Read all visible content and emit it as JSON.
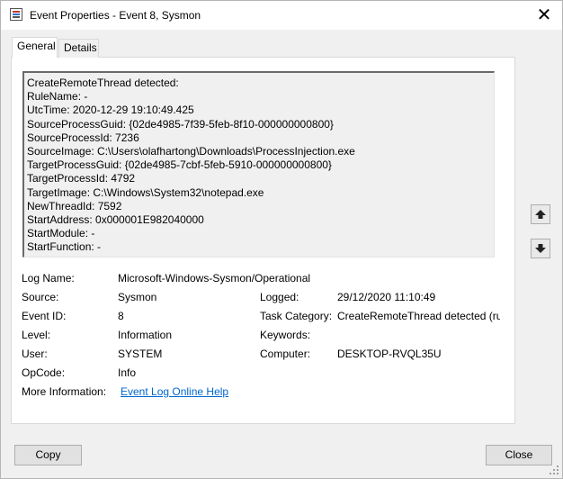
{
  "window": {
    "title": "Event Properties - Event 8, Sysmon",
    "icon": "event-viewer-icon",
    "close_glyph": "✕"
  },
  "tabs": [
    {
      "label": "General",
      "active": true
    },
    {
      "label": "Details",
      "active": false
    }
  ],
  "description": [
    "CreateRemoteThread detected:",
    "RuleName: -",
    "UtcTime: 2020-12-29 19:10:49.425",
    "SourceProcessGuid: {02de4985-7f39-5feb-8f10-000000000800}",
    "SourceProcessId: 7236",
    "SourceImage: C:\\Users\\olafhartong\\Downloads\\ProcessInjection.exe",
    "TargetProcessGuid: {02de4985-7cbf-5feb-5910-000000000800}",
    "TargetProcessId: 4792",
    "TargetImage: C:\\Windows\\System32\\notepad.exe",
    "NewThreadId: 7592",
    "StartAddress: 0x000001E982040000",
    "StartModule: -",
    "StartFunction: -"
  ],
  "fields": {
    "log_name": {
      "label": "Log Name:",
      "value": "Microsoft-Windows-Sysmon/Operational"
    },
    "source": {
      "label": "Source:",
      "value": "Sysmon"
    },
    "logged": {
      "label": "Logged:",
      "value": "29/12/2020 11:10:49"
    },
    "event_id": {
      "label": "Event ID:",
      "value": "8"
    },
    "task_category": {
      "label": "Task Category:",
      "value": "CreateRemoteThread detected (rul"
    },
    "level": {
      "label": "Level:",
      "value": "Information"
    },
    "keywords": {
      "label": "Keywords:",
      "value": ""
    },
    "user": {
      "label": "User:",
      "value": "SYSTEM"
    },
    "computer": {
      "label": "Computer:",
      "value": "DESKTOP-RVQL35U"
    },
    "opcode": {
      "label": "OpCode:",
      "value": "Info"
    },
    "more_info": {
      "label": "More Information:",
      "value": "Event Log Online Help"
    }
  },
  "buttons": {
    "copy": "Copy",
    "close": "Close"
  },
  "colors": {
    "link": "#0066cc",
    "window_bg": "#f0f0f0",
    "panel_bg": "#ffffff"
  }
}
